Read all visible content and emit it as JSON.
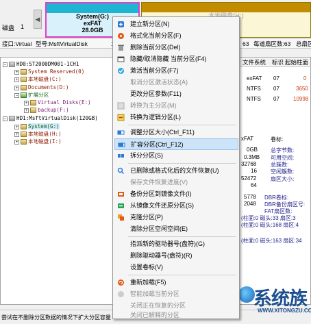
{
  "disk_map": {
    "disk_label": "磁盘",
    "disk_number": "1",
    "left_arrow": "◀",
    "sys_partition": {
      "name": "System(G:)",
      "fs": "exFAT",
      "size": "28.0GB"
    },
    "h_partition": {
      "name": "本地磁盘(H:)",
      "fs": "NTFS"
    }
  },
  "info_row": {
    "interface": "接口:Virtual",
    "model": "型号:MsftVirtualDisk",
    "extra": "1",
    "sectors_per_track": "63",
    "sectors_per_track_label": "每道扇区数:63",
    "total_sectors": "总扇区"
  },
  "tree": {
    "items": [
      {
        "label": "HD0:ST2000DM001-1CH1",
        "color": "c-blk",
        "icon": "disk"
      },
      {
        "label": "System Reserved(0)",
        "color": "c-red",
        "icon": "partition"
      },
      {
        "label": "本地磁盘(C:)",
        "color": "c-red",
        "icon": "partition"
      },
      {
        "label": "Documents(D:)",
        "color": "c-red",
        "icon": "partition"
      },
      {
        "label": "扩展分区",
        "color": "c-grn",
        "icon": "extended"
      },
      {
        "label": "Virtual Disks(E:)",
        "color": "c-pur",
        "icon": "partition"
      },
      {
        "label": "backup(F:)",
        "color": "c-pur",
        "icon": "partition"
      },
      {
        "label": "HD1:MsftVirtualDisk(120GB)",
        "color": "c-blk",
        "icon": "disk"
      },
      {
        "label": "System(G:)",
        "color": "c-grn",
        "icon": "partition"
      },
      {
        "label": "本地磁盘(H:)",
        "color": "c-red",
        "icon": "partition"
      },
      {
        "label": "本地磁盘(I:)",
        "color": "c-red",
        "icon": "partition"
      }
    ]
  },
  "right_panel": {
    "headers": [
      "文件系统",
      "标识",
      "起始柱面"
    ],
    "rows": [
      {
        "fs": "exFAT",
        "id": "07",
        "start": "0"
      },
      {
        "fs": "NTFS",
        "id": "07",
        "start": "3650"
      },
      {
        "fs": "NTFS",
        "id": "07",
        "start": "10998"
      }
    ],
    "detail": {
      "fs_tag": "xFAT",
      "vol_label_key": "卷标:",
      "size1": "0GB",
      "total_bytes_key": "总字节数:",
      "size2": "0.3MB",
      "free_key": "可用空间:",
      "v3": "32768",
      "cluster_key": "总簇数:",
      "v4": "16",
      "free_cluster_key": "空闲簇数:",
      "v5": "52472",
      "sector_size_key": "扇区大小:",
      "v6": "64",
      "dbr_key": "DBR卷标:",
      "v7": "5778",
      "dbr_backup_key": "DBR备份扇区号:",
      "v8": "2048",
      "fat_key": "FAT扇区数:",
      "rows": [
        "(柱面:0 磁头:33 扇区:3",
        "(柱面:0 磁头:168 扇区:4",
        "(柱面:0 磁头:163 扇区:34"
      ]
    }
  },
  "context_menu": {
    "items": [
      {
        "label": "建立新分区(N)",
        "icon": "new-partition-icon",
        "disabled": false
      },
      {
        "label": "格式化当前分区(F)",
        "icon": "format-icon",
        "disabled": false
      },
      {
        "label": "删除当前分区(Del)",
        "icon": "delete-icon",
        "disabled": false
      },
      {
        "label": "隐藏/取消隐藏 当前分区(F4)",
        "icon": "hide-icon",
        "disabled": false
      },
      {
        "label": "激活当前分区(F7)",
        "icon": "activate-icon",
        "disabled": false
      },
      {
        "label": "取消分区激活状态(A)",
        "icon": "",
        "disabled": true
      },
      {
        "label": "更改分区参数(F11)",
        "icon": "",
        "disabled": false
      },
      {
        "label": "转换为主分区(M)",
        "icon": "convert-primary-icon",
        "disabled": true
      },
      {
        "label": "转换为逻辑分区(L)",
        "icon": "convert-logical-icon",
        "disabled": false
      },
      {
        "label": "调整分区大小(Ctrl_F11)",
        "icon": "resize-icon",
        "disabled": false
      },
      {
        "label": "扩容分区(Ctrl_F12)",
        "icon": "expand-icon",
        "disabled": false
      },
      {
        "label": "拆分分区(S)",
        "icon": "split-icon",
        "disabled": false
      },
      {
        "label": "已删除或格式化后的文件恢复(U)",
        "icon": "recover-icon",
        "disabled": false
      },
      {
        "label": "保存文件恢复进度(V)",
        "icon": "",
        "disabled": true
      },
      {
        "label": "备份分区到镜像文件(I)",
        "icon": "backup-icon",
        "disabled": false
      },
      {
        "label": "从镜像文件还原分区(S)",
        "icon": "restore-icon",
        "disabled": false
      },
      {
        "label": "克隆分区(P)",
        "icon": "clone-icon",
        "disabled": false
      },
      {
        "label": "清除分区空闲空间(E)",
        "icon": "",
        "disabled": false
      },
      {
        "label": "指派新的驱动器号(盘符)(G)",
        "icon": "",
        "disabled": false
      },
      {
        "label": "删除驱动器号(盘符)(R)",
        "icon": "",
        "disabled": false
      },
      {
        "label": "设置卷标(V)",
        "icon": "",
        "disabled": false
      },
      {
        "label": "重新加载(F5)",
        "icon": "reload-icon",
        "disabled": false
      },
      {
        "label": "智能加载当前分区",
        "icon": "smart-load-icon",
        "disabled": true
      },
      {
        "label": "关闭正在恢复的分区",
        "icon": "",
        "disabled": true
      },
      {
        "label": "关闭已解释的分区",
        "icon": "",
        "disabled": true
      },
      {
        "label": "打开16进制扇区编辑",
        "icon": "",
        "disabled": false
      }
    ]
  },
  "status_bar": {
    "text": "尝试在不删除分区数据的情况下扩大分区容量"
  },
  "watermark": {
    "text": "系统族",
    "url": "WWW.XITONGZU.COM"
  },
  "colors": {
    "sys_border": "#e040c8",
    "sys_stripe": "#1fb4d2",
    "h_stripe": "#c38b00",
    "menu_highlight": "#cde3f7"
  }
}
